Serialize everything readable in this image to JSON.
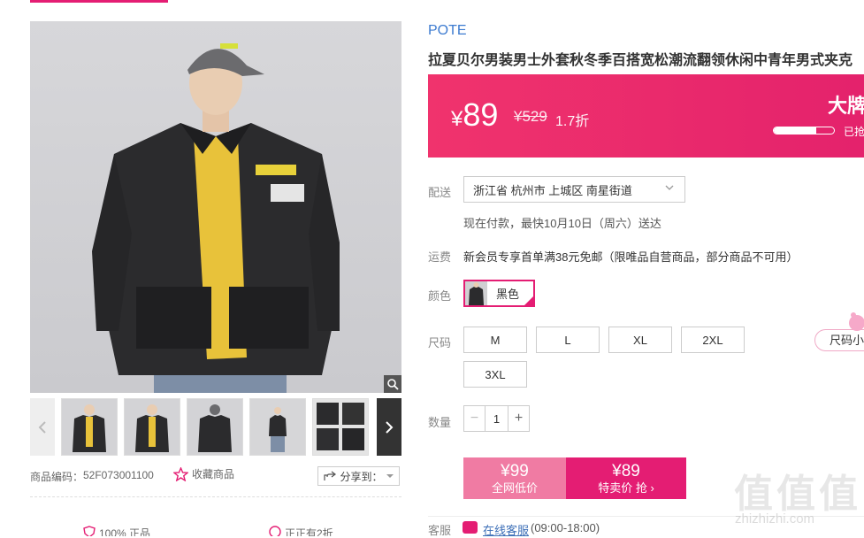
{
  "gallery": {
    "thumbnails": [
      "thumb-1",
      "thumb-2",
      "thumb-3",
      "thumb-4",
      "thumb-5",
      "thumb-6"
    ],
    "product_code_label": "商品编码：",
    "product_code": "52F073001100",
    "favorite_label": "收藏商品",
    "share_label": "分享到：",
    "guarantee_1": "100% 正品",
    "guarantee_2": "正正有2折"
  },
  "product": {
    "brand": "POTE",
    "title": "拉夏贝尔男装男士外套秋冬季百搭宽松潮流翻领休闲中青年男式夹克"
  },
  "price": {
    "currency": "¥",
    "current": "89",
    "original": "¥529",
    "discount": "1.7折",
    "promo_title": "大牌特",
    "progress_label": "已抢",
    "progress_fraction": 0.7
  },
  "delivery": {
    "label": "配送",
    "address": "浙江省 杭州市 上城区 南星街道",
    "eta": "现在付款，最快10月10日（周六）送达"
  },
  "shipping": {
    "label": "运费",
    "text": "新会员专享首单满38元免邮（限唯品自营商品，部分商品不可用）"
  },
  "color": {
    "label": "颜色",
    "selected": "黑色"
  },
  "size": {
    "label": "尺码",
    "options": [
      "M",
      "L",
      "XL",
      "2XL",
      "3XL"
    ],
    "tip": "尺码小"
  },
  "quantity": {
    "label": "数量",
    "value": "1",
    "minus": "−",
    "plus": "+"
  },
  "buy": {
    "normal_price": "¥99",
    "normal_label": "全网低价",
    "sale_price": "¥89",
    "sale_label": "特卖价 抢 ›"
  },
  "service": {
    "label": "客服",
    "link": "在线客服",
    "hours": "(09:00-18:00)"
  },
  "watermark": {
    "mark": "值值值",
    "url": "zhizhizhi.com"
  },
  "colors": {
    "accent": "#e41d73",
    "brand_blue": "#3d7bd0"
  }
}
